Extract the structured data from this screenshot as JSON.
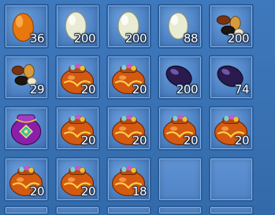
{
  "inventory": {
    "rows": [
      [
        {
          "item": "orange-egg-icon",
          "count": "36"
        },
        {
          "item": "white-egg-icon",
          "count": "200"
        },
        {
          "item": "white-egg-icon",
          "count": "200"
        },
        {
          "item": "white-egg-icon",
          "count": "88"
        },
        {
          "item": "mixed-beans-icon",
          "count": "200"
        }
      ],
      [
        {
          "item": "mixed-beans-icon",
          "count": "29"
        },
        {
          "item": "treasure-pouch-icon",
          "count": "20"
        },
        {
          "item": "treasure-pouch-icon",
          "count": "20"
        },
        {
          "item": "dark-egg-icon",
          "count": "200"
        },
        {
          "item": "dark-egg-icon",
          "count": "74"
        }
      ],
      [
        {
          "item": "purple-pouch-icon",
          "count": ""
        },
        {
          "item": "treasure-pouch-icon",
          "count": "20"
        },
        {
          "item": "treasure-pouch-icon",
          "count": "20"
        },
        {
          "item": "treasure-pouch-icon",
          "count": "20"
        },
        {
          "item": "treasure-pouch-icon",
          "count": "20"
        }
      ],
      [
        {
          "item": "treasure-pouch-icon",
          "count": "20"
        },
        {
          "item": "treasure-pouch-icon",
          "count": "20"
        },
        {
          "item": "treasure-pouch-icon",
          "count": "18"
        },
        {
          "item": "",
          "count": ""
        },
        {
          "item": "",
          "count": ""
        }
      ]
    ]
  },
  "colors": {
    "slot_bg": "#4f84c6",
    "slot_border": "#2a5d9b",
    "count_text": "#ffffff"
  }
}
